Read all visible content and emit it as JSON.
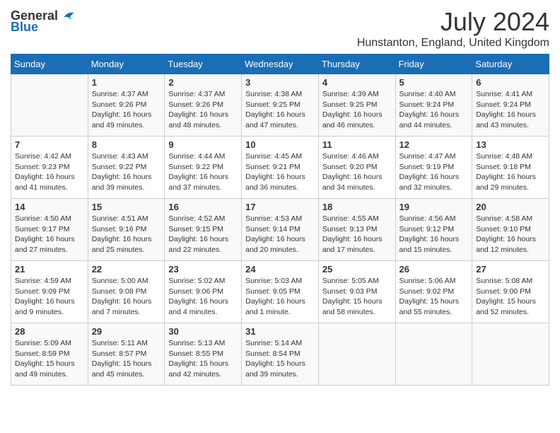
{
  "header": {
    "logo_general": "General",
    "logo_blue": "Blue",
    "month_year": "July 2024",
    "location": "Hunstanton, England, United Kingdom"
  },
  "calendar": {
    "days_of_week": [
      "Sunday",
      "Monday",
      "Tuesday",
      "Wednesday",
      "Thursday",
      "Friday",
      "Saturday"
    ],
    "weeks": [
      [
        {
          "day": "",
          "info": ""
        },
        {
          "day": "1",
          "info": "Sunrise: 4:37 AM\nSunset: 9:26 PM\nDaylight: 16 hours and 49 minutes."
        },
        {
          "day": "2",
          "info": "Sunrise: 4:37 AM\nSunset: 9:26 PM\nDaylight: 16 hours and 48 minutes."
        },
        {
          "day": "3",
          "info": "Sunrise: 4:38 AM\nSunset: 9:25 PM\nDaylight: 16 hours and 47 minutes."
        },
        {
          "day": "4",
          "info": "Sunrise: 4:39 AM\nSunset: 9:25 PM\nDaylight: 16 hours and 46 minutes."
        },
        {
          "day": "5",
          "info": "Sunrise: 4:40 AM\nSunset: 9:24 PM\nDaylight: 16 hours and 44 minutes."
        },
        {
          "day": "6",
          "info": "Sunrise: 4:41 AM\nSunset: 9:24 PM\nDaylight: 16 hours and 43 minutes."
        }
      ],
      [
        {
          "day": "7",
          "info": "Sunrise: 4:42 AM\nSunset: 9:23 PM\nDaylight: 16 hours and 41 minutes."
        },
        {
          "day": "8",
          "info": "Sunrise: 4:43 AM\nSunset: 9:22 PM\nDaylight: 16 hours and 39 minutes."
        },
        {
          "day": "9",
          "info": "Sunrise: 4:44 AM\nSunset: 9:22 PM\nDaylight: 16 hours and 37 minutes."
        },
        {
          "day": "10",
          "info": "Sunrise: 4:45 AM\nSunset: 9:21 PM\nDaylight: 16 hours and 36 minutes."
        },
        {
          "day": "11",
          "info": "Sunrise: 4:46 AM\nSunset: 9:20 PM\nDaylight: 16 hours and 34 minutes."
        },
        {
          "day": "12",
          "info": "Sunrise: 4:47 AM\nSunset: 9:19 PM\nDaylight: 16 hours and 32 minutes."
        },
        {
          "day": "13",
          "info": "Sunrise: 4:48 AM\nSunset: 9:18 PM\nDaylight: 16 hours and 29 minutes."
        }
      ],
      [
        {
          "day": "14",
          "info": "Sunrise: 4:50 AM\nSunset: 9:17 PM\nDaylight: 16 hours and 27 minutes."
        },
        {
          "day": "15",
          "info": "Sunrise: 4:51 AM\nSunset: 9:16 PM\nDaylight: 16 hours and 25 minutes."
        },
        {
          "day": "16",
          "info": "Sunrise: 4:52 AM\nSunset: 9:15 PM\nDaylight: 16 hours and 22 minutes."
        },
        {
          "day": "17",
          "info": "Sunrise: 4:53 AM\nSunset: 9:14 PM\nDaylight: 16 hours and 20 minutes."
        },
        {
          "day": "18",
          "info": "Sunrise: 4:55 AM\nSunset: 9:13 PM\nDaylight: 16 hours and 17 minutes."
        },
        {
          "day": "19",
          "info": "Sunrise: 4:56 AM\nSunset: 9:12 PM\nDaylight: 16 hours and 15 minutes."
        },
        {
          "day": "20",
          "info": "Sunrise: 4:58 AM\nSunset: 9:10 PM\nDaylight: 16 hours and 12 minutes."
        }
      ],
      [
        {
          "day": "21",
          "info": "Sunrise: 4:59 AM\nSunset: 9:09 PM\nDaylight: 16 hours and 9 minutes."
        },
        {
          "day": "22",
          "info": "Sunrise: 5:00 AM\nSunset: 9:08 PM\nDaylight: 16 hours and 7 minutes."
        },
        {
          "day": "23",
          "info": "Sunrise: 5:02 AM\nSunset: 9:06 PM\nDaylight: 16 hours and 4 minutes."
        },
        {
          "day": "24",
          "info": "Sunrise: 5:03 AM\nSunset: 9:05 PM\nDaylight: 16 hours and 1 minute."
        },
        {
          "day": "25",
          "info": "Sunrise: 5:05 AM\nSunset: 9:03 PM\nDaylight: 15 hours and 58 minutes."
        },
        {
          "day": "26",
          "info": "Sunrise: 5:06 AM\nSunset: 9:02 PM\nDaylight: 15 hours and 55 minutes."
        },
        {
          "day": "27",
          "info": "Sunrise: 5:08 AM\nSunset: 9:00 PM\nDaylight: 15 hours and 52 minutes."
        }
      ],
      [
        {
          "day": "28",
          "info": "Sunrise: 5:09 AM\nSunset: 8:59 PM\nDaylight: 15 hours and 49 minutes."
        },
        {
          "day": "29",
          "info": "Sunrise: 5:11 AM\nSunset: 8:57 PM\nDaylight: 15 hours and 45 minutes."
        },
        {
          "day": "30",
          "info": "Sunrise: 5:13 AM\nSunset: 8:55 PM\nDaylight: 15 hours and 42 minutes."
        },
        {
          "day": "31",
          "info": "Sunrise: 5:14 AM\nSunset: 8:54 PM\nDaylight: 15 hours and 39 minutes."
        },
        {
          "day": "",
          "info": ""
        },
        {
          "day": "",
          "info": ""
        },
        {
          "day": "",
          "info": ""
        }
      ]
    ]
  }
}
